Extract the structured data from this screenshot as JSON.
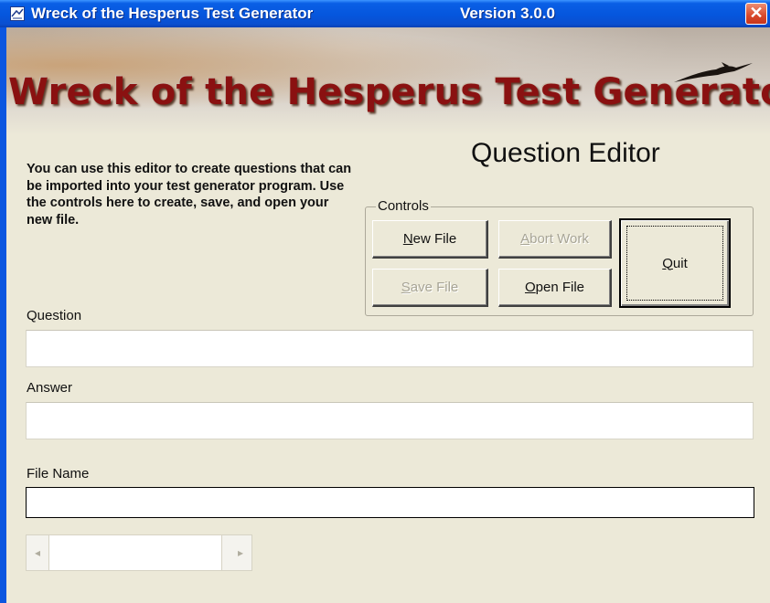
{
  "window": {
    "title": "Wreck of the Hesperus Test Generator",
    "version": "Version 3.0.0",
    "close_glyph": "✕",
    "app_icon": "app-logo-icon"
  },
  "banner": {
    "title": "Wreck of the Hesperus Test Generator",
    "decoration_icon": "bird-icon"
  },
  "editor": {
    "section_title": "Question Editor",
    "intro": "You can use this editor to create questions that can be imported into your test generator program.  Use the controls here to create, save, and open your new file."
  },
  "controls": {
    "legend": "Controls",
    "new_file": {
      "mnemonic": "N",
      "rest": "ew File",
      "enabled": true
    },
    "abort_work": {
      "mnemonic": "A",
      "rest": "bort Work",
      "enabled": false
    },
    "save_file": {
      "mnemonic": "S",
      "rest": "ave File",
      "enabled": false
    },
    "open_file": {
      "mnemonic": "O",
      "rest": "pen File",
      "enabled": true
    },
    "quit": {
      "mnemonic": "Q",
      "rest": "uit",
      "enabled": true
    }
  },
  "fields": {
    "question": {
      "label": "Question",
      "value": ""
    },
    "answer": {
      "label": "Answer",
      "value": ""
    },
    "file_name": {
      "label": "File Name",
      "value": ""
    }
  },
  "scrollbar": {
    "left_arrow": "◂",
    "right_arrow": "▸"
  },
  "colors": {
    "titlebar": "#0556dd",
    "window_bg": "#ece9d8",
    "banner_text": "#8a1111",
    "disabled_text": "#a7a495",
    "close_button": "#d9482a"
  }
}
